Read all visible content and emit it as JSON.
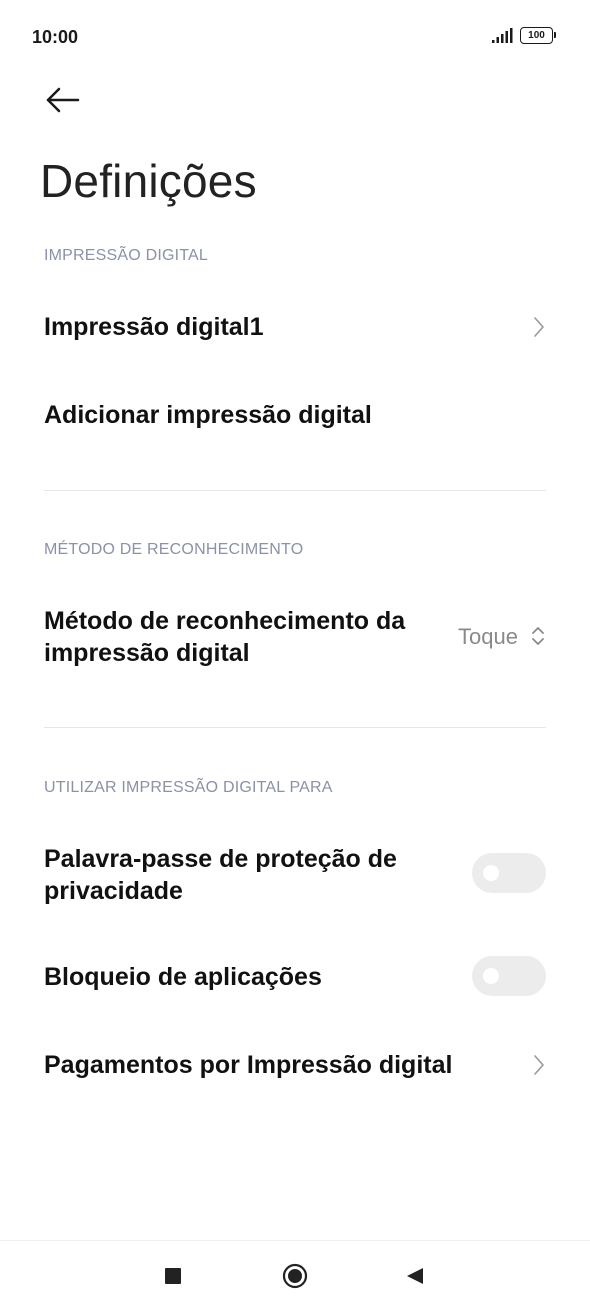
{
  "status_bar": {
    "time": "10:00",
    "battery": "100",
    "icons": [
      "signal-icon",
      "battery-icon"
    ]
  },
  "header": {
    "back_icon": "arrow-left-icon",
    "title": "Definições"
  },
  "sections": {
    "fingerprint": {
      "header": "IMPRESSÃO DIGITAL",
      "item_1": "Impressão digital1",
      "add_item": "Adicionar impressão digital"
    },
    "recognition": {
      "header": "MÉTODO DE RECONHECIMENTO",
      "item_line1": "Método de reconhecimento da",
      "item_line2": "impressão digital",
      "value": "Toque"
    },
    "use_for": {
      "header": "UTILIZAR IMPRESSÃO DIGITAL PARA",
      "privacy_line1": "Palavra-passe de proteção de",
      "privacy_line2": "privacidade",
      "privacy_enabled": false,
      "app_lock": "Bloqueio de aplicações",
      "app_lock_enabled": false,
      "payments": "Pagamentos por Impressão digital"
    }
  },
  "nav_bar": {
    "icons": [
      "recents-square-icon",
      "home-circle-icon",
      "back-triangle-icon"
    ]
  },
  "colors": {
    "section_header": "#8a92a8",
    "toggle_off": "#ececec",
    "divider": "#e6e6e6"
  }
}
